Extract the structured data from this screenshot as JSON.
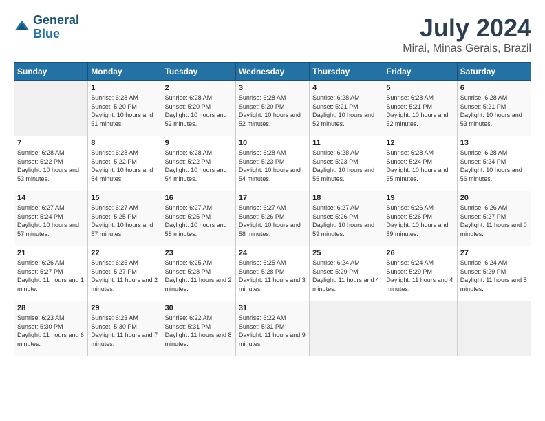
{
  "header": {
    "logo_line1": "General",
    "logo_line2": "Blue",
    "month_year": "July 2024",
    "location": "Mirai, Minas Gerais, Brazil"
  },
  "weekdays": [
    "Sunday",
    "Monday",
    "Tuesday",
    "Wednesday",
    "Thursday",
    "Friday",
    "Saturday"
  ],
  "weeks": [
    [
      {
        "day": "",
        "sunrise": "",
        "sunset": "",
        "daylight": ""
      },
      {
        "day": "1",
        "sunrise": "6:28 AM",
        "sunset": "5:20 PM",
        "daylight": "10 hours and 51 minutes."
      },
      {
        "day": "2",
        "sunrise": "6:28 AM",
        "sunset": "5:20 PM",
        "daylight": "10 hours and 52 minutes."
      },
      {
        "day": "3",
        "sunrise": "6:28 AM",
        "sunset": "5:20 PM",
        "daylight": "10 hours and 52 minutes."
      },
      {
        "day": "4",
        "sunrise": "6:28 AM",
        "sunset": "5:21 PM",
        "daylight": "10 hours and 52 minutes."
      },
      {
        "day": "5",
        "sunrise": "6:28 AM",
        "sunset": "5:21 PM",
        "daylight": "10 hours and 52 minutes."
      },
      {
        "day": "6",
        "sunrise": "6:28 AM",
        "sunset": "5:21 PM",
        "daylight": "10 hours and 53 minutes."
      }
    ],
    [
      {
        "day": "7",
        "sunrise": "6:28 AM",
        "sunset": "5:22 PM",
        "daylight": "10 hours and 53 minutes."
      },
      {
        "day": "8",
        "sunrise": "6:28 AM",
        "sunset": "5:22 PM",
        "daylight": "10 hours and 54 minutes."
      },
      {
        "day": "9",
        "sunrise": "6:28 AM",
        "sunset": "5:22 PM",
        "daylight": "10 hours and 54 minutes."
      },
      {
        "day": "10",
        "sunrise": "6:28 AM",
        "sunset": "5:23 PM",
        "daylight": "10 hours and 54 minutes."
      },
      {
        "day": "11",
        "sunrise": "6:28 AM",
        "sunset": "5:23 PM",
        "daylight": "10 hours and 55 minutes."
      },
      {
        "day": "12",
        "sunrise": "6:28 AM",
        "sunset": "5:24 PM",
        "daylight": "10 hours and 55 minutes."
      },
      {
        "day": "13",
        "sunrise": "6:28 AM",
        "sunset": "5:24 PM",
        "daylight": "10 hours and 56 minutes."
      }
    ],
    [
      {
        "day": "14",
        "sunrise": "6:27 AM",
        "sunset": "5:24 PM",
        "daylight": "10 hours and 57 minutes."
      },
      {
        "day": "15",
        "sunrise": "6:27 AM",
        "sunset": "5:25 PM",
        "daylight": "10 hours and 57 minutes."
      },
      {
        "day": "16",
        "sunrise": "6:27 AM",
        "sunset": "5:25 PM",
        "daylight": "10 hours and 58 minutes."
      },
      {
        "day": "17",
        "sunrise": "6:27 AM",
        "sunset": "5:26 PM",
        "daylight": "10 hours and 58 minutes."
      },
      {
        "day": "18",
        "sunrise": "6:27 AM",
        "sunset": "5:26 PM",
        "daylight": "10 hours and 59 minutes."
      },
      {
        "day": "19",
        "sunrise": "6:26 AM",
        "sunset": "5:26 PM",
        "daylight": "10 hours and 59 minutes."
      },
      {
        "day": "20",
        "sunrise": "6:26 AM",
        "sunset": "5:27 PM",
        "daylight": "11 hours and 0 minutes."
      }
    ],
    [
      {
        "day": "21",
        "sunrise": "6:26 AM",
        "sunset": "5:27 PM",
        "daylight": "11 hours and 1 minute."
      },
      {
        "day": "22",
        "sunrise": "6:25 AM",
        "sunset": "5:27 PM",
        "daylight": "11 hours and 2 minutes."
      },
      {
        "day": "23",
        "sunrise": "6:25 AM",
        "sunset": "5:28 PM",
        "daylight": "11 hours and 2 minutes."
      },
      {
        "day": "24",
        "sunrise": "6:25 AM",
        "sunset": "5:28 PM",
        "daylight": "11 hours and 3 minutes."
      },
      {
        "day": "25",
        "sunrise": "6:24 AM",
        "sunset": "5:29 PM",
        "daylight": "11 hours and 4 minutes."
      },
      {
        "day": "26",
        "sunrise": "6:24 AM",
        "sunset": "5:29 PM",
        "daylight": "11 hours and 4 minutes."
      },
      {
        "day": "27",
        "sunrise": "6:24 AM",
        "sunset": "5:29 PM",
        "daylight": "11 hours and 5 minutes."
      }
    ],
    [
      {
        "day": "28",
        "sunrise": "6:23 AM",
        "sunset": "5:30 PM",
        "daylight": "11 hours and 6 minutes."
      },
      {
        "day": "29",
        "sunrise": "6:23 AM",
        "sunset": "5:30 PM",
        "daylight": "11 hours and 7 minutes."
      },
      {
        "day": "30",
        "sunrise": "6:22 AM",
        "sunset": "5:31 PM",
        "daylight": "11 hours and 8 minutes."
      },
      {
        "day": "31",
        "sunrise": "6:22 AM",
        "sunset": "5:31 PM",
        "daylight": "11 hours and 9 minutes."
      },
      {
        "day": "",
        "sunrise": "",
        "sunset": "",
        "daylight": ""
      },
      {
        "day": "",
        "sunrise": "",
        "sunset": "",
        "daylight": ""
      },
      {
        "day": "",
        "sunrise": "",
        "sunset": "",
        "daylight": ""
      }
    ]
  ],
  "labels": {
    "sunrise_prefix": "Sunrise: ",
    "sunset_prefix": "Sunset: ",
    "daylight_prefix": "Daylight: "
  }
}
